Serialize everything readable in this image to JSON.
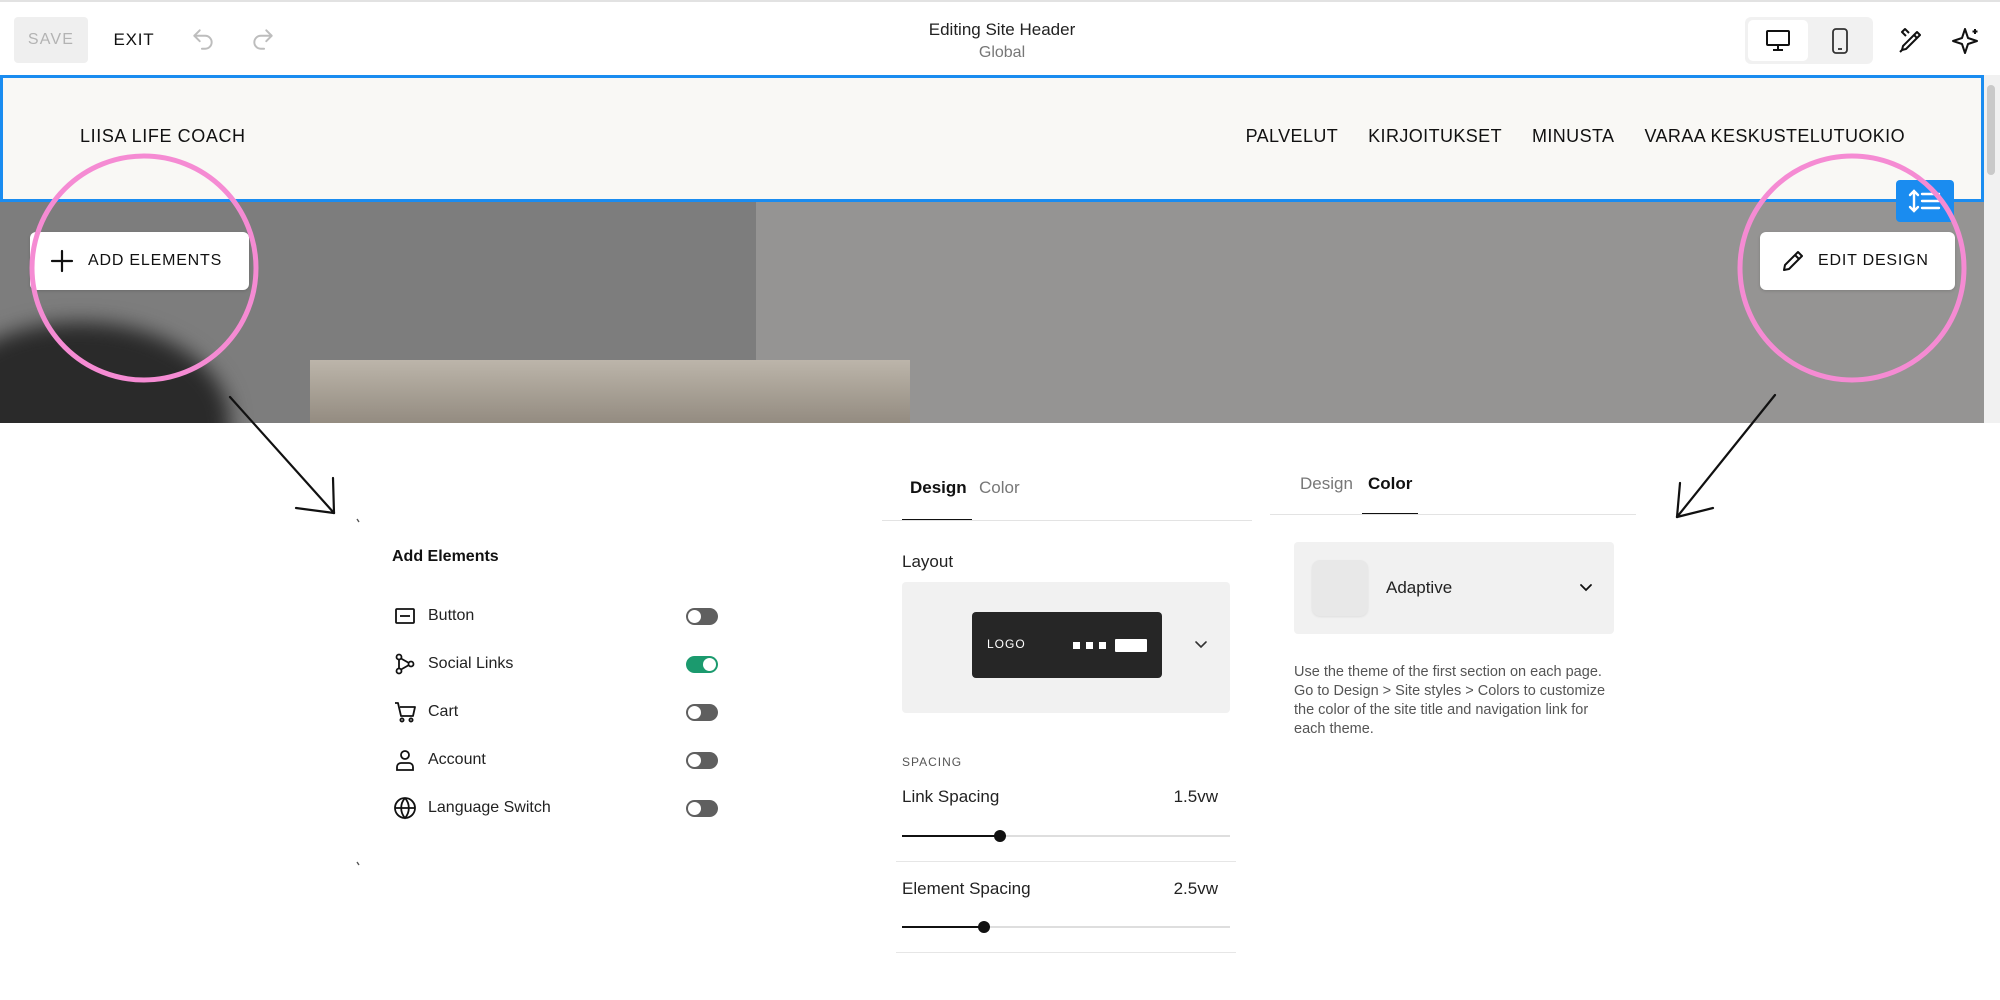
{
  "toolbar": {
    "save_label": "SAVE",
    "exit_label": "EXIT",
    "title": "Editing Site Header",
    "subtitle": "Global",
    "undo_icon": "undo-icon",
    "redo_icon": "redo-icon",
    "device_options": [
      "desktop-icon",
      "mobile-icon"
    ],
    "selected_device": "desktop",
    "right_icons": [
      "brush-icon",
      "sparkle-icon"
    ]
  },
  "site_header": {
    "site_title": "LIISA LIFE COACH",
    "nav_links": [
      "PALVELUT",
      "KIRJOITUKSET",
      "MINUSTA",
      "VARAA KESKUSTELUTUOKIO"
    ],
    "selection_color": "#1a8cf0"
  },
  "editor_buttons": {
    "add_elements": "ADD ELEMENTS",
    "edit_design": "EDIT DESIGN"
  },
  "add_elements_panel": {
    "heading": "Add Elements",
    "items": [
      {
        "label": "Button",
        "icon": "button-icon",
        "enabled": false
      },
      {
        "label": "Social Links",
        "icon": "social-links-icon",
        "enabled": true
      },
      {
        "label": "Cart",
        "icon": "cart-icon",
        "enabled": false
      },
      {
        "label": "Account",
        "icon": "account-icon",
        "enabled": false
      },
      {
        "label": "Language Switch",
        "icon": "globe-icon",
        "enabled": false
      }
    ],
    "toggle_on_color": "#1b9a6e"
  },
  "design_panel": {
    "tabs": [
      "Design",
      "Color"
    ],
    "active_tab": "Design",
    "layout_label": "Layout",
    "layout_preview_logo": "LOGO",
    "spacing_heading": "SPACING",
    "sliders": [
      {
        "label": "Link Spacing",
        "value": "1.5vw",
        "fraction": 0.3
      },
      {
        "label": "Element Spacing",
        "value": "2.5vw",
        "fraction": 0.25
      }
    ]
  },
  "color_panel": {
    "tabs": [
      "Design",
      "Color"
    ],
    "active_tab": "Color",
    "selected_theme": "Adaptive",
    "help_text": "Use the theme of the first section on each page. Go to Design > Site styles > Colors to customize the color of the site title and navigation link for each theme."
  },
  "annotations": {
    "highlight_color": "#f58bd3"
  }
}
